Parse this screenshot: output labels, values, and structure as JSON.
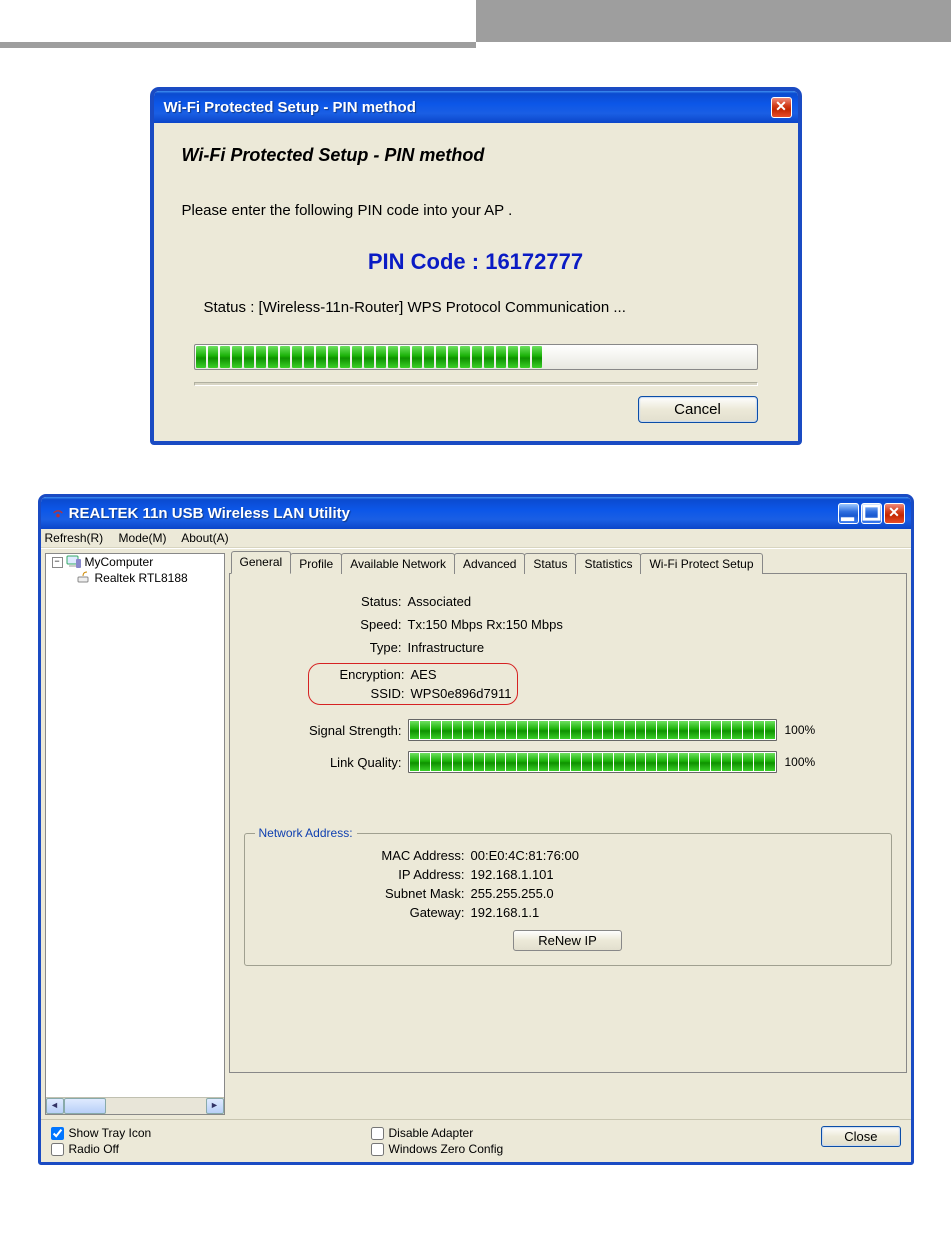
{
  "dialog1": {
    "title": "Wi-Fi Protected Setup - PIN method",
    "heading": "Wi-Fi Protected Setup - PIN method",
    "instruction": "Please enter the following PIN code into your AP .",
    "pin_label": "PIN Code :  16172777",
    "status_line": "Status :   [Wireless-11n-Router] WPS Protocol Communication ...",
    "progress_segments": 29,
    "cancel_label": "Cancel"
  },
  "app": {
    "title": "REALTEK 11n USB Wireless LAN Utility",
    "menu": {
      "refresh": "Refresh(R)",
      "mode": "Mode(M)",
      "about": "About(A)"
    },
    "tree": {
      "root": "MyComputer",
      "child": "Realtek RTL8188"
    },
    "tabs": {
      "general": "General",
      "profile": "Profile",
      "available": "Available Network",
      "advanced": "Advanced",
      "status": "Status",
      "statistics": "Statistics",
      "wps": "Wi-Fi Protect Setup"
    },
    "general": {
      "labels": {
        "status": "Status:",
        "speed": "Speed:",
        "type": "Type:",
        "encryption": "Encryption:",
        "ssid": "SSID:",
        "signal": "Signal Strength:",
        "link": "Link Quality:"
      },
      "values": {
        "status": "Associated",
        "speed": "Tx:150 Mbps Rx:150 Mbps",
        "type": "Infrastructure",
        "encryption": "AES",
        "ssid": "WPS0e896d7911"
      },
      "signal_pct": "100%",
      "link_pct": "100%"
    },
    "network": {
      "legend": "Network Address:",
      "labels": {
        "mac": "MAC Address:",
        "ip": "IP Address:",
        "subnet": "Subnet Mask:",
        "gateway": "Gateway:"
      },
      "values": {
        "mac": "00:E0:4C:81:76:00",
        "ip": "192.168.1.101",
        "subnet": "255.255.255.0",
        "gateway": "192.168.1.1"
      },
      "renew_label": "ReNew IP"
    },
    "footer": {
      "show_tray": "Show Tray Icon",
      "radio_off": "Radio Off",
      "disable_adapter": "Disable Adapter",
      "zero_config": "Windows Zero Config",
      "close": "Close"
    }
  }
}
